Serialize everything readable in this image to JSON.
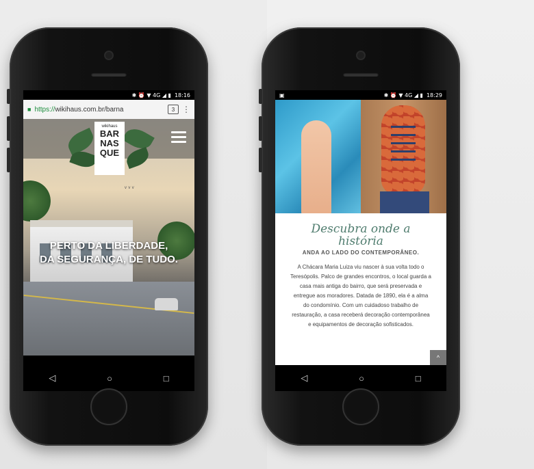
{
  "left_phone": {
    "status": {
      "icons": "✱ ⏰ ▼ 4G ◢ ▮",
      "time": "18:16"
    },
    "browser": {
      "url_scheme": "https://",
      "url_rest": "wikihaus.com.br/barna",
      "tabs_count": "3",
      "menu_icon": "kebab-icon"
    },
    "site": {
      "logo_small": "wikihaus",
      "logo_line1": "BAR",
      "logo_line2": "NAS",
      "logo_line3": "QUE",
      "headline_line1": "PERTO DA LIBERDADE,",
      "headline_line2": "DA SEGURANÇA, DE TUDO."
    },
    "nav": {
      "back": "◁",
      "home": "○",
      "recent": "□"
    }
  },
  "right_phone": {
    "status": {
      "left_icon": "▣",
      "icons": "✱ ⏰ ▼ 4G ◢ ▮",
      "time": "18:29"
    },
    "site": {
      "title_line1": "Descubra onde a",
      "title_line2": "história",
      "subtitle": "ANDA AO LADO DO CONTEMPORÂNEO.",
      "paragraph": "A Chácara Maria Luiza viu nascer à sua volta todo o Teresópolis. Palco de grandes encontros, o local guarda a casa mais antiga do bairro, que será preservada e entregue aos moradores. Datada de 1890, ela é a alma do condomínio. Com um cuidadoso trabalho de restauração, a casa receberá decoração contemporânea e equipamentos de decoração sofisticados.",
      "scroll_top": "^"
    },
    "nav": {
      "back": "◁",
      "home": "○",
      "recent": "□"
    }
  }
}
